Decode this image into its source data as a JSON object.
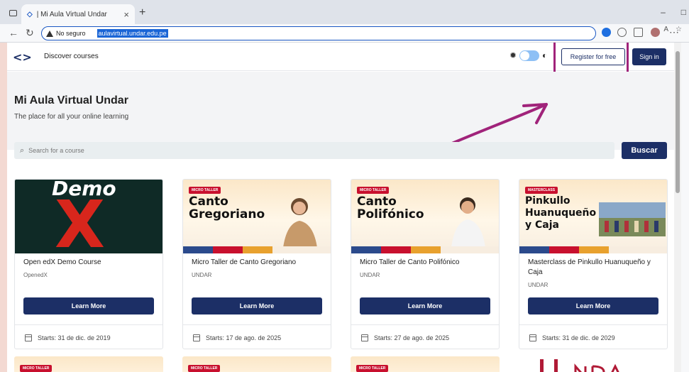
{
  "browser": {
    "tab_title": "| Mi Aula Virtual Undar",
    "tab_close": "×",
    "new_tab": "+",
    "minimize": "–",
    "maximize": "□",
    "not_secure": "No seguro",
    "url": "aulavirtual.undar.edu.pe"
  },
  "nav": {
    "logo": "<>",
    "discover": "Discover courses",
    "register": "Register for free",
    "signin": "Sign in"
  },
  "hero": {
    "title": "Mi Aula Virtual Undar",
    "subtitle": "The place for all your online learning"
  },
  "search": {
    "placeholder": "Search for a course",
    "button": "Buscar"
  },
  "courses": [
    {
      "title": "Open edX Demo Course",
      "org": "OpenedX",
      "button": "Learn More",
      "start": "Starts: 31 de dic. de 2019",
      "banner_word": "Demo",
      "banner_mark": "X"
    },
    {
      "title": "Micro Taller de Canto Gregoriano",
      "org": "UNDAR",
      "button": "Learn More",
      "start": "Starts: 17 de ago. de 2025",
      "badge": "MICRO TALLER",
      "banner_line1": "Canto",
      "banner_line2": "Gregoriano"
    },
    {
      "title": "Micro Taller de Canto Polifónico",
      "org": "UNDAR",
      "button": "Learn More",
      "start": "Starts: 27 de ago. de 2025",
      "badge": "MICRO TALLER",
      "banner_line1": "Canto",
      "banner_line2": "Polifónico"
    },
    {
      "title": "Masterclass de Pinkullo Huanuqueño y Caja",
      "org": "UNDAR",
      "button": "Learn More",
      "start": "Starts: 31 de dic. de 2029",
      "badge": "MASTERCLASS",
      "banner_line1": "Pinkullo",
      "banner_line2": "Huanuqueño",
      "banner_line3": "y Caja"
    }
  ],
  "row2_badges": [
    "MICRO TALLER",
    "MICRO TALLER",
    "MICRO TALLER"
  ],
  "colors": {
    "primary": "#1c2f66",
    "highlight": "#a0237a",
    "badge_red": "#c8102e"
  }
}
